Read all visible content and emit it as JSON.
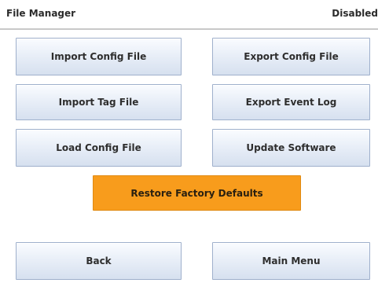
{
  "header": {
    "title": "File Manager",
    "status": "Disabled"
  },
  "buttons": {
    "import_config": "Import Config File",
    "export_config": "Export Config File",
    "import_tag": "Import Tag File",
    "export_event_log": "Export Event Log",
    "load_config": "Load Config File",
    "update_software": "Update Software",
    "restore_defaults": "Restore Factory Defaults",
    "back": "Back",
    "main_menu": "Main Menu"
  },
  "colors": {
    "restore_button": "#f89c1c",
    "button_gradient_top": "#fafcff",
    "button_gradient_bottom": "#d6e0ef",
    "button_border": "#9fb0cc"
  }
}
